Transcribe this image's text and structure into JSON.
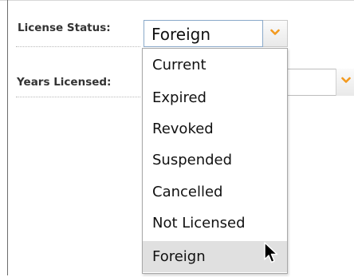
{
  "form": {
    "license_status": {
      "label": "License Status:",
      "selected_value": "Foreign",
      "options": [
        "Current",
        "Expired",
        "Revoked",
        "Suspended",
        "Cancelled",
        "Not Licensed",
        "Foreign"
      ],
      "highlighted_option": "Foreign",
      "dropdown_open": true
    },
    "years_licensed": {
      "label": "Years Licensed:",
      "selected_value": ""
    }
  },
  "icons": {
    "dropdown_arrow": "chevron-down-icon",
    "pointer": "mouse-cursor-icon"
  },
  "colors": {
    "chevron": "#f39a1f",
    "option_highlight": "#e0e0e0",
    "select_border": "#8aa9c9"
  }
}
